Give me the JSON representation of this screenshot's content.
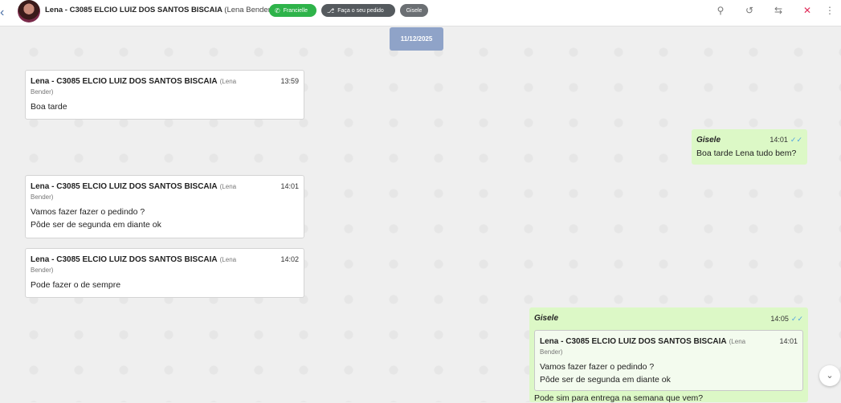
{
  "header": {
    "back_icon": "chevron-left-icon",
    "contact_name": "Lena - C3085 ELCIO LUIZ DOS SANTOS BISCAIA",
    "contact_sub": "(Lena Bender)",
    "tags": [
      {
        "label": "Francielle",
        "icon": "whatsapp-icon",
        "color": "#2eb34a"
      },
      {
        "label": "Faça o seu pedido",
        "icon": "flow-icon",
        "color": "#555a5e"
      },
      {
        "label": "Gisele",
        "color": "#6b6f73"
      }
    ],
    "tools": [
      "search-icon",
      "history-icon",
      "transfer-icon",
      "close-ticket-icon",
      "more-icon"
    ]
  },
  "chat": {
    "date": "11/12/2025",
    "messages": [
      {
        "sender": "Lena - C3085 ELCIO LUIZ DOS SANTOS BISCAIA",
        "sender_sub_1": "(Lena",
        "sender_sub_2": "Bender)",
        "time": "13:59",
        "lines": [
          "Boa tarde"
        ]
      },
      {
        "sender": "Gisele",
        "time": "14:01",
        "lines": [
          "Boa tarde Lena tudo bem?"
        ]
      },
      {
        "sender": "Lena - C3085 ELCIO LUIZ DOS SANTOS BISCAIA",
        "sender_sub_1": "(Lena",
        "sender_sub_2": "Bender)",
        "time": "14:01",
        "lines": [
          "Vamos fazer fazer o pedindo ?",
          "Pôde ser de segunda em diante ok"
        ]
      },
      {
        "sender": "Lena - C3085 ELCIO LUIZ DOS SANTOS BISCAIA",
        "sender_sub_1": "(Lena",
        "sender_sub_2": "Bender)",
        "time": "14:02",
        "lines": [
          "Pode fazer o de sempre"
        ]
      },
      {
        "sender": "Gisele",
        "time": "14:05",
        "quote": {
          "sender": "Lena - C3085 ELCIO LUIZ DOS SANTOS BISCAIA",
          "sender_sub_1": "(Lena",
          "sender_sub_2": "Bender)",
          "time": "14:01",
          "lines": [
            "Vamos fazer fazer o pedindo ?",
            "Pôde ser de segunda em diante ok"
          ]
        },
        "lines": [
          "Pode sim para entrega na semana que vem?"
        ]
      }
    ]
  },
  "scroll_down_icon": "chevron-down-icon"
}
